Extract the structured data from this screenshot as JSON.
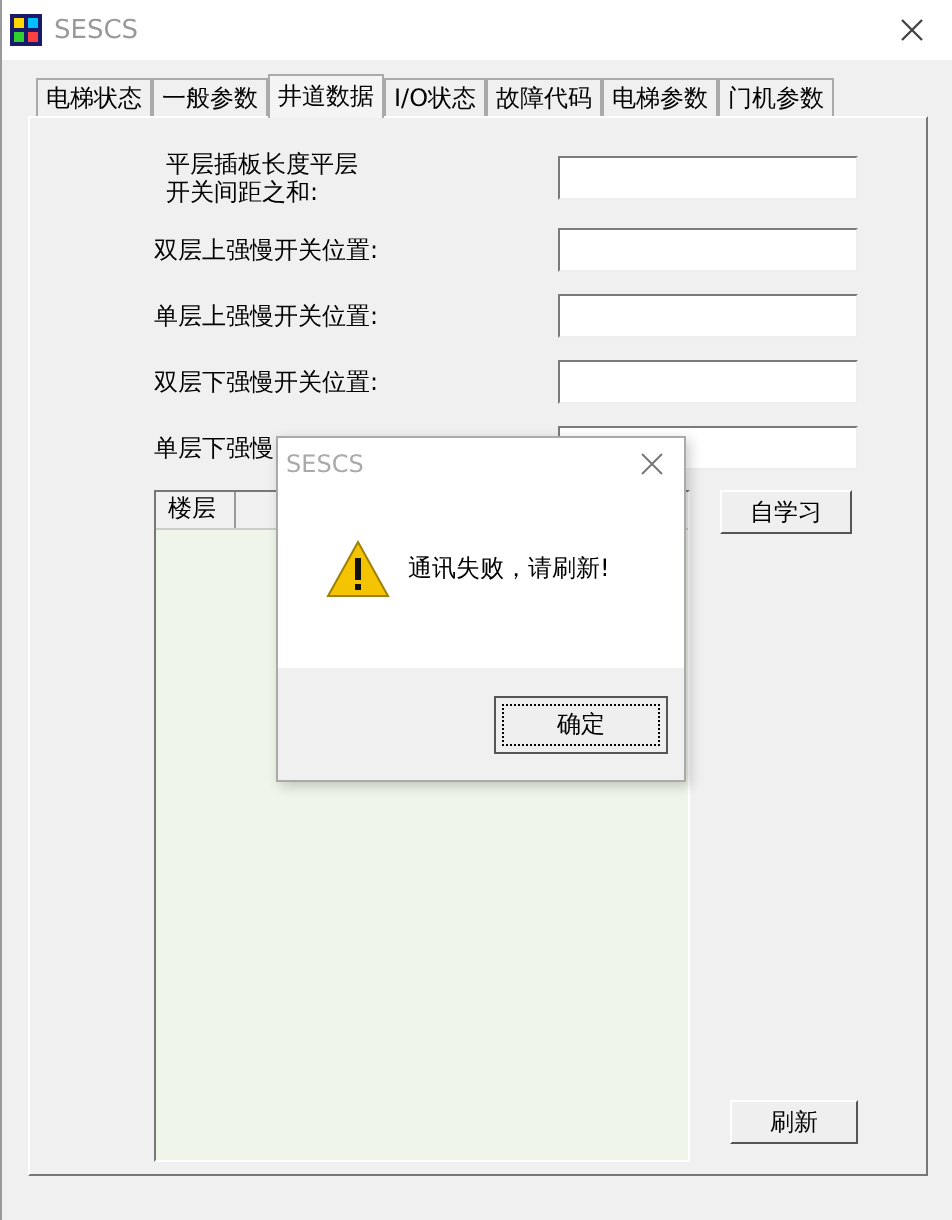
{
  "window": {
    "title": "SESCS"
  },
  "tabs": [
    {
      "label": "电梯状态",
      "selected": false
    },
    {
      "label": "一般参数",
      "selected": false
    },
    {
      "label": "井道数据",
      "selected": true
    },
    {
      "label": "I/O状态",
      "selected": false
    },
    {
      "label": "故障代码",
      "selected": false
    },
    {
      "label": "电梯参数",
      "selected": false
    },
    {
      "label": "门机参数",
      "selected": false
    }
  ],
  "fields": [
    {
      "label": "平层插板长度平层开关间距之和:"
    },
    {
      "label": "双层上强慢开关位置:"
    },
    {
      "label": "单层上强慢开关位置:"
    },
    {
      "label": "双层下强慢开关位置:"
    },
    {
      "label": "单层下强慢"
    }
  ],
  "table": {
    "columns": [
      "楼层"
    ]
  },
  "buttons": {
    "learn": "自学习",
    "refresh": "刷新"
  },
  "dialog": {
    "title": "SESCS",
    "message": "通讯失败，请刷新!",
    "button": "确定"
  }
}
